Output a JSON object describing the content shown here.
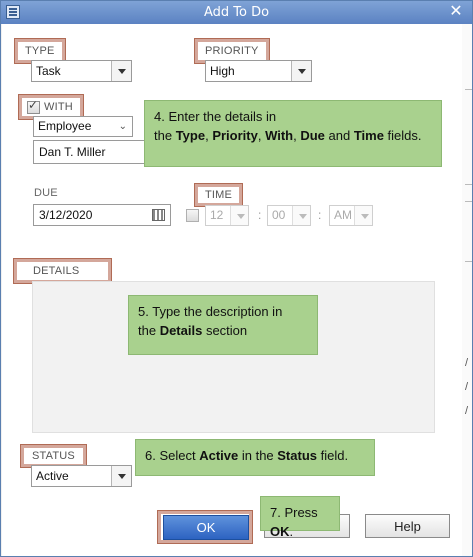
{
  "window": {
    "title": "Add To Do"
  },
  "type": {
    "label": "TYPE",
    "value": "Task"
  },
  "priority": {
    "label": "PRIORITY",
    "value": "High"
  },
  "with": {
    "label": "WITH",
    "checked": true,
    "value": "Employee",
    "name_value": "Dan T. Miller"
  },
  "due": {
    "label": "DUE",
    "value": "3/12/2020"
  },
  "time": {
    "label": "TIME",
    "hour": "12",
    "minute": "00",
    "ampm": "AM",
    "sep1": ":",
    "sep2": ":"
  },
  "details": {
    "label": "DETAILS"
  },
  "status": {
    "label": "STATUS",
    "value": "Active"
  },
  "buttons": {
    "ok": "OK",
    "help": "Help"
  },
  "callouts": {
    "step4": {
      "line1": "4. Enter the details in",
      "pre": "the ",
      "b1": "Type",
      "c1": ", ",
      "b2": "Priority",
      "c2": ", ",
      "b3": "With",
      "c3": ", ",
      "b4": "Due",
      "c4": " and ",
      "b5": "Time",
      "post": " fields."
    },
    "step5": {
      "line1": "5. Type the description in",
      "pre": "the ",
      "b1": "Details",
      "post": " section"
    },
    "step6": {
      "pre": "6. Select ",
      "b1": "Active",
      "mid": " in the ",
      "b2": "Status",
      "post": " field."
    },
    "step7": {
      "pre": "7. Press ",
      "b1": "OK",
      "post": "."
    }
  },
  "edge_glyphs": [
    "/",
    "/",
    "/"
  ]
}
